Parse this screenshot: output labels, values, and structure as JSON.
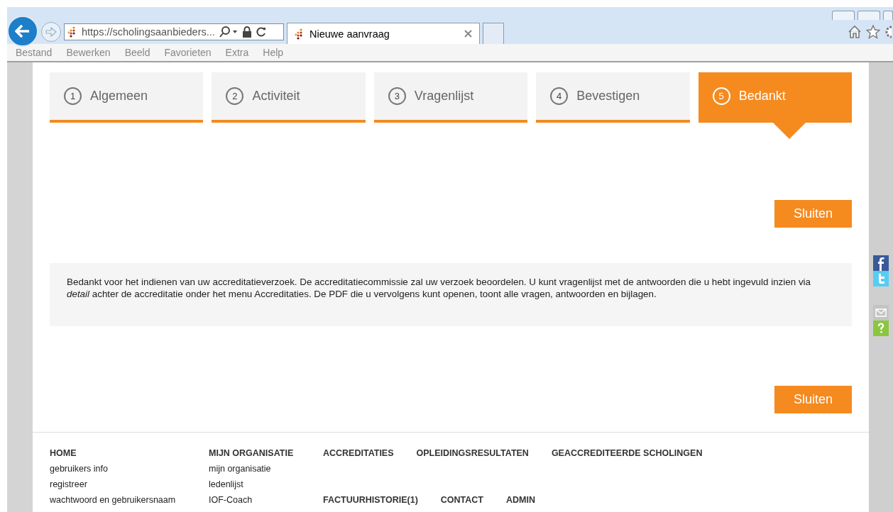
{
  "browser": {
    "address": "https://scholingsaanbieders...",
    "tab": {
      "title": "Nieuwe aanvraag",
      "selected": true
    },
    "menu": [
      "Bestand",
      "Bewerken",
      "Beeld",
      "Favorieten",
      "Extra",
      "Help"
    ]
  },
  "steps": [
    {
      "number": "1",
      "label": "Algemeen",
      "selected": false
    },
    {
      "number": "2",
      "label": "Activiteit",
      "selected": false
    },
    {
      "number": "3",
      "label": "Vragenlijst",
      "selected": false
    },
    {
      "number": "4",
      "label": "Bevestigen",
      "selected": false
    },
    {
      "number": "5",
      "label": "Bedankt",
      "selected": true
    }
  ],
  "close_button_top": "Sluiten",
  "message": "Bedankt voor het indienen van uw accreditatieverzoek. De accreditatiecommissie zal uw verzoek beoordelen.  U kunt vragenlijst met de antwoorden die u hebt ingevuld inzien via *detail* achter de accreditatie onder het menu Accreditaties. De PDF die u vervolgens kunt openen, toont alle vragen, antwoorden en bijlagen.",
  "close_button_bottom": "Sluiten",
  "footer": {
    "columns": [
      {
        "heading": "HOME",
        "links": [
          "gebruikers info",
          "registreer",
          "wachtwoord en gebruikersnaam"
        ]
      },
      {
        "heading": "MIJN ORGANISATIE",
        "links": [
          "mijn organisatie",
          "ledenlijst",
          "IOF-Coach"
        ]
      }
    ],
    "top_links": [
      "ACCREDITATIES",
      "OPLEIDINGSRESULTATEN",
      "GEACCREDITEERDE SCHOLINGEN"
    ],
    "bottom_links": [
      "FACTUURHISTORIE(1)",
      "CONTACT",
      "ADMIN"
    ]
  }
}
